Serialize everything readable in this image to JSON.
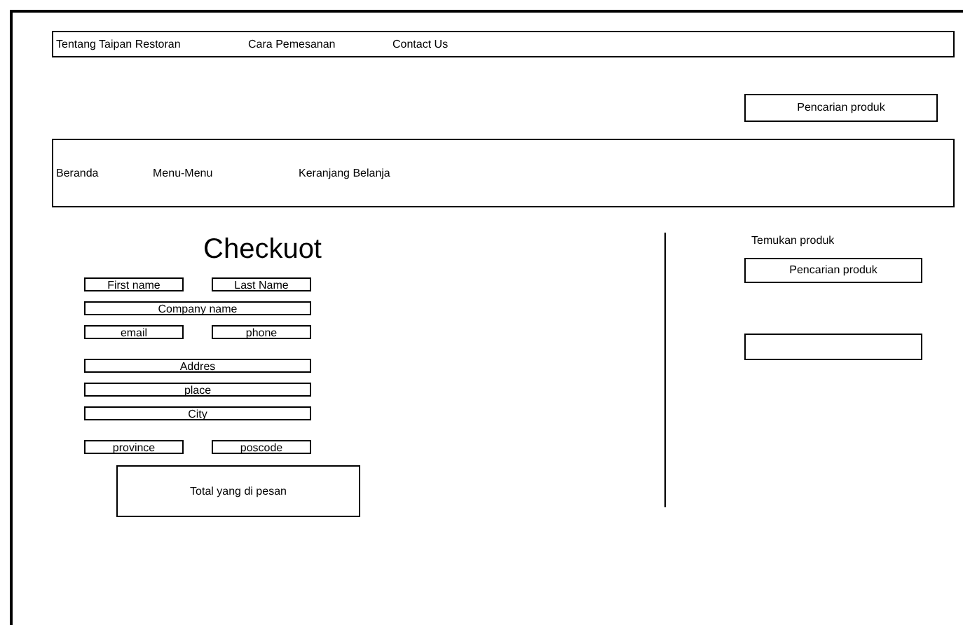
{
  "top_nav": [
    "Tentang Taipan Restoran",
    "Cara Pemesanan",
    "Contact Us"
  ],
  "header_search": {
    "label": "Pencarian produk"
  },
  "main_nav": [
    "Beranda",
    "Menu-Menu",
    "Keranjang Belanja"
  ],
  "checkout": {
    "title": "Checkuot",
    "groups": [
      [
        [
          {
            "placeholder": "First name"
          },
          {
            "placeholder": "Last Name"
          }
        ],
        [
          {
            "placeholder": "Company name"
          }
        ],
        [
          {
            "placeholder": "email"
          },
          {
            "placeholder": "phone"
          }
        ]
      ],
      [
        [
          {
            "placeholder": "Addres"
          }
        ],
        [
          {
            "placeholder": "place"
          }
        ],
        [
          {
            "placeholder": "City"
          }
        ]
      ],
      [
        [
          {
            "placeholder": "province"
          },
          {
            "placeholder": "poscode"
          }
        ]
      ]
    ],
    "total": "Total yang di pesan"
  },
  "sidebar": {
    "heading": "Temukan produk",
    "search": {
      "label": "Pencarian produk"
    }
  }
}
